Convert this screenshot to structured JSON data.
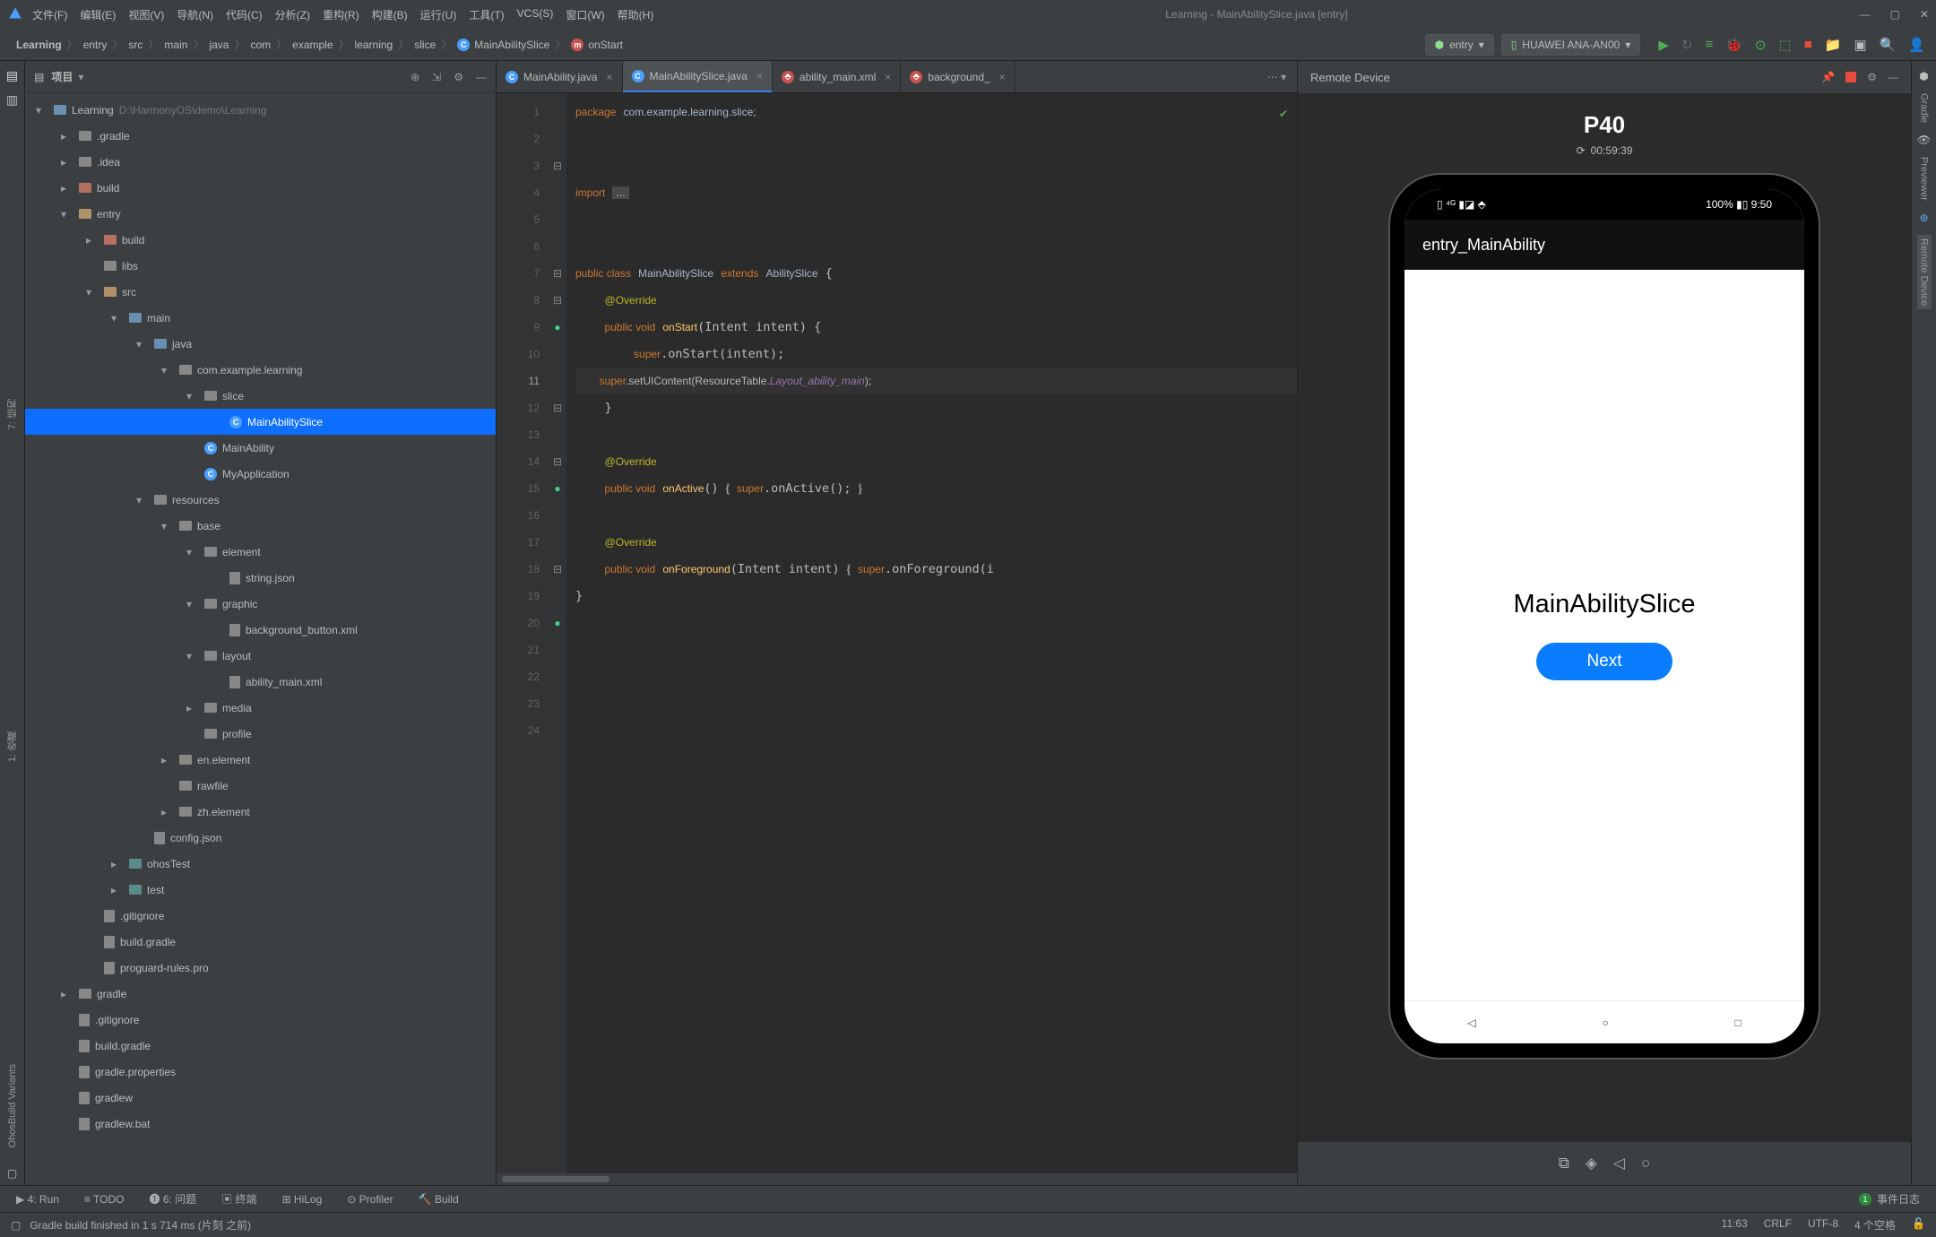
{
  "menubar": {
    "items": [
      "文件(F)",
      "编辑(E)",
      "视图(V)",
      "导航(N)",
      "代码(C)",
      "分析(Z)",
      "重构(R)",
      "构建(B)",
      "运行(U)",
      "工具(T)",
      "VCS(S)",
      "窗口(W)",
      "帮助(H)"
    ],
    "title": "Learning - MainAbilitySlice.java [entry]"
  },
  "breadcrumb": [
    "Learning",
    "entry",
    "src",
    "main",
    "java",
    "com",
    "example",
    "learning",
    "slice",
    "MainAbilitySlice",
    "onStart"
  ],
  "run_config": "entry",
  "device": "HUAWEI ANA-AN00",
  "project_panel": {
    "label": "项目"
  },
  "tree": [
    {
      "d": 0,
      "a": "▾",
      "i": "folder-blue",
      "t": "Learning",
      "s": "D:\\HarmonyOS\\demo\\Learning"
    },
    {
      "d": 1,
      "a": "▸",
      "i": "folder-gray",
      "t": ".gradle"
    },
    {
      "d": 1,
      "a": "▸",
      "i": "folder-gray",
      "t": ".idea"
    },
    {
      "d": 1,
      "a": "▸",
      "i": "folder-red",
      "t": "build"
    },
    {
      "d": 1,
      "a": "▾",
      "i": "folder",
      "t": "entry"
    },
    {
      "d": 2,
      "a": "▸",
      "i": "folder-red",
      "t": "build"
    },
    {
      "d": 2,
      "a": "",
      "i": "folder-gray",
      "t": "libs"
    },
    {
      "d": 2,
      "a": "▾",
      "i": "folder",
      "t": "src"
    },
    {
      "d": 3,
      "a": "▾",
      "i": "folder-blue",
      "t": "main"
    },
    {
      "d": 4,
      "a": "▾",
      "i": "folder-blue",
      "t": "java"
    },
    {
      "d": 5,
      "a": "▾",
      "i": "folder-gray",
      "t": "com.example.learning"
    },
    {
      "d": 6,
      "a": "▾",
      "i": "folder-gray",
      "t": "slice"
    },
    {
      "d": 7,
      "a": "",
      "i": "dot-c",
      "t": "MainAbilitySlice",
      "sel": true
    },
    {
      "d": 6,
      "a": "",
      "i": "dot-c",
      "t": "MainAbility"
    },
    {
      "d": 6,
      "a": "",
      "i": "dot-c",
      "t": "MyApplication"
    },
    {
      "d": 4,
      "a": "▾",
      "i": "folder-gray",
      "t": "resources"
    },
    {
      "d": 5,
      "a": "▾",
      "i": "folder-gray",
      "t": "base"
    },
    {
      "d": 6,
      "a": "▾",
      "i": "folder-gray",
      "t": "element"
    },
    {
      "d": 7,
      "a": "",
      "i": "file",
      "t": "string.json"
    },
    {
      "d": 6,
      "a": "▾",
      "i": "folder-gray",
      "t": "graphic"
    },
    {
      "d": 7,
      "a": "",
      "i": "file",
      "t": "background_button.xml"
    },
    {
      "d": 6,
      "a": "▾",
      "i": "folder-gray",
      "t": "layout"
    },
    {
      "d": 7,
      "a": "",
      "i": "file",
      "t": "ability_main.xml"
    },
    {
      "d": 6,
      "a": "▸",
      "i": "folder-gray",
      "t": "media"
    },
    {
      "d": 6,
      "a": "",
      "i": "folder-gray",
      "t": "profile"
    },
    {
      "d": 5,
      "a": "▸",
      "i": "folder-gray",
      "t": "en.element"
    },
    {
      "d": 5,
      "a": "",
      "i": "folder-gray",
      "t": "rawfile"
    },
    {
      "d": 5,
      "a": "▸",
      "i": "folder-gray",
      "t": "zh.element"
    },
    {
      "d": 4,
      "a": "",
      "i": "file",
      "t": "config.json"
    },
    {
      "d": 3,
      "a": "▸",
      "i": "folder-teal",
      "t": "ohosTest"
    },
    {
      "d": 3,
      "a": "▸",
      "i": "folder-teal",
      "t": "test"
    },
    {
      "d": 2,
      "a": "",
      "i": "file",
      "t": ".gitignore"
    },
    {
      "d": 2,
      "a": "",
      "i": "file",
      "t": "build.gradle"
    },
    {
      "d": 2,
      "a": "",
      "i": "file",
      "t": "proguard-rules.pro"
    },
    {
      "d": 1,
      "a": "▸",
      "i": "folder-gray",
      "t": "gradle"
    },
    {
      "d": 1,
      "a": "",
      "i": "file",
      "t": ".gitignore"
    },
    {
      "d": 1,
      "a": "",
      "i": "file",
      "t": "build.gradle"
    },
    {
      "d": 1,
      "a": "",
      "i": "file",
      "t": "gradle.properties"
    },
    {
      "d": 1,
      "a": "",
      "i": "file",
      "t": "gradlew"
    },
    {
      "d": 1,
      "a": "",
      "i": "file",
      "t": "gradlew.bat"
    }
  ],
  "tabs": [
    {
      "icon": "c-blue",
      "label": "MainAbility.java",
      "active": false
    },
    {
      "icon": "c-blue",
      "label": "MainAbilitySlice.java",
      "active": true
    },
    {
      "icon": "xml",
      "label": "ability_main.xml",
      "active": false
    },
    {
      "icon": "xml",
      "label": "background_",
      "active": false
    }
  ],
  "line_count": 24,
  "current_line": 11,
  "preview": {
    "label": "Remote Device",
    "device": "P40",
    "timer": "00:59:39",
    "status_left": "▯ ⁴ᴳ ▮◪ ⬘",
    "status_right": "100% ▮▯ 9:50",
    "app_title": "entry_MainAbility",
    "slice_text": "MainAbilitySlice",
    "button": "Next"
  },
  "bottom_tabs": [
    "▶ 4: Run",
    "≡ TODO",
    "❶ 6: 问题",
    "▣ 终端",
    "⊞ HiLog",
    "⊙ Profiler",
    "🔨 Build"
  ],
  "event_log": "事件日志",
  "status": {
    "msg": "Gradle build finished in 1 s 714 ms (片刻 之前)",
    "pos": "11:63",
    "eol": "CRLF",
    "enc": "UTF-8",
    "indent": "4 个空格"
  },
  "left_sidebar_items": [
    "1: 收藏",
    "7: 结构"
  ],
  "left_sidebar_bottom": "OhosBuild Variants",
  "right_sidebar_items": [
    "Gradle",
    "Previewer",
    "Remote Device"
  ]
}
